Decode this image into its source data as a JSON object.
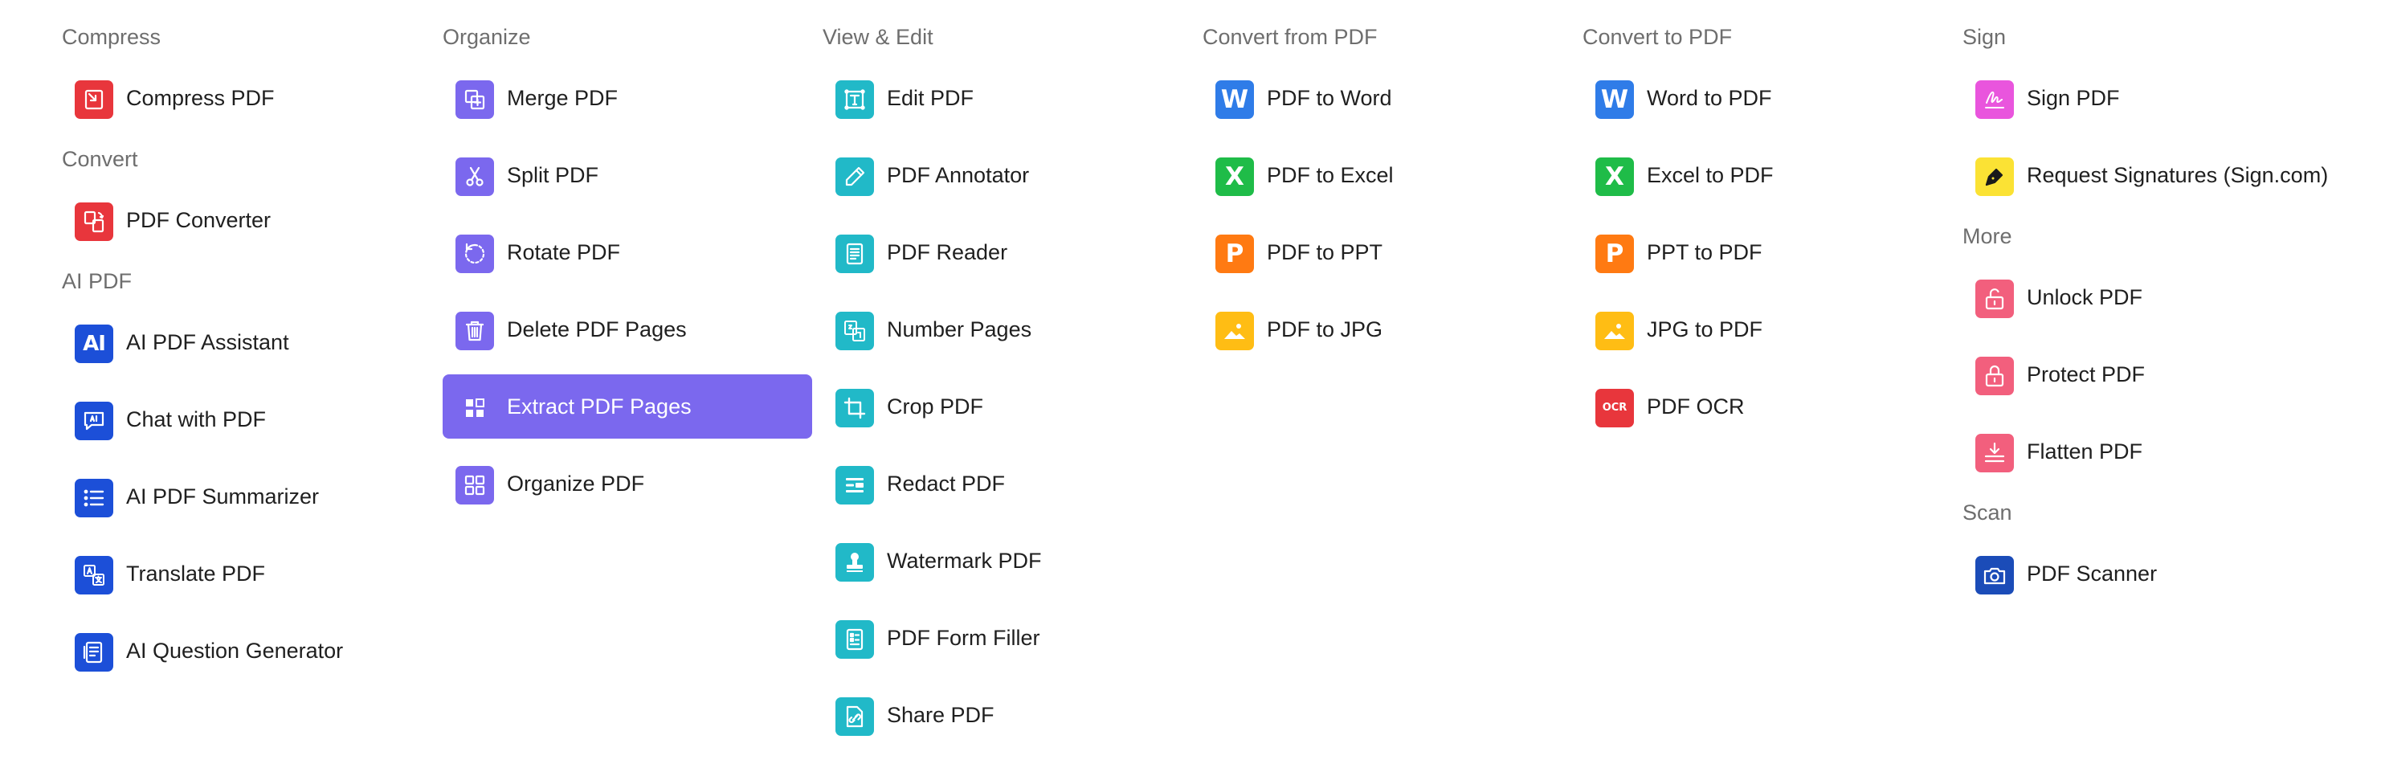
{
  "colors": {
    "red": "#e8363c",
    "purple": "#7b68ee",
    "teal": "#21b9c8",
    "blue": "#1c4fd8",
    "word_blue": "#2f7ce8",
    "excel_green": "#1fbc48",
    "ppt_orange": "#ff7a12",
    "jpg_yellow": "#ffbd14",
    "sign_magenta": "#e955dd",
    "sign_yellow": "#fbe234",
    "pink": "#f25f7d",
    "navy": "#1b4cb8",
    "active_bg": "#7b68ee"
  },
  "columns": [
    {
      "sections": [
        {
          "title": "Compress",
          "items": [
            {
              "label": "Compress PDF",
              "icon": "compress-icon"
            }
          ]
        },
        {
          "title": "Convert",
          "items": [
            {
              "label": "PDF Converter",
              "icon": "converter-icon"
            }
          ]
        },
        {
          "title": "AI PDF",
          "items": [
            {
              "label": "AI PDF Assistant",
              "icon": "ai-icon"
            },
            {
              "label": "Chat with PDF",
              "icon": "chat-icon"
            },
            {
              "label": "AI PDF Summarizer",
              "icon": "list-icon"
            },
            {
              "label": "Translate PDF",
              "icon": "translate-icon"
            },
            {
              "label": "AI Question Generator",
              "icon": "question-icon"
            }
          ]
        }
      ]
    },
    {
      "sections": [
        {
          "title": "Organize",
          "items": [
            {
              "label": "Merge PDF",
              "icon": "merge-icon"
            },
            {
              "label": "Split PDF",
              "icon": "scissors-icon"
            },
            {
              "label": "Rotate PDF",
              "icon": "rotate-icon"
            },
            {
              "label": "Delete PDF Pages",
              "icon": "trash-icon"
            },
            {
              "label": "Extract PDF Pages",
              "icon": "extract-icon",
              "active": true
            },
            {
              "label": "Organize PDF",
              "icon": "grid-icon"
            }
          ]
        }
      ]
    },
    {
      "sections": [
        {
          "title": "View & Edit",
          "items": [
            {
              "label": "Edit PDF",
              "icon": "text-edit-icon"
            },
            {
              "label": "PDF Annotator",
              "icon": "pencil-icon"
            },
            {
              "label": "PDF Reader",
              "icon": "document-icon"
            },
            {
              "label": "Number Pages",
              "icon": "number-pages-icon"
            },
            {
              "label": "Crop PDF",
              "icon": "crop-icon"
            },
            {
              "label": "Redact PDF",
              "icon": "redact-icon"
            },
            {
              "label": "Watermark PDF",
              "icon": "stamp-icon"
            },
            {
              "label": "PDF Form Filler",
              "icon": "form-icon"
            },
            {
              "label": "Share PDF",
              "icon": "share-icon"
            }
          ]
        }
      ]
    },
    {
      "sections": [
        {
          "title": "Convert from PDF",
          "items": [
            {
              "label": "PDF to Word",
              "icon": "word-icon"
            },
            {
              "label": "PDF to Excel",
              "icon": "excel-icon"
            },
            {
              "label": "PDF to PPT",
              "icon": "ppt-icon"
            },
            {
              "label": "PDF to JPG",
              "icon": "image-icon"
            }
          ]
        }
      ]
    },
    {
      "sections": [
        {
          "title": "Convert to PDF",
          "items": [
            {
              "label": "Word to PDF",
              "icon": "word-icon"
            },
            {
              "label": "Excel to PDF",
              "icon": "excel-icon"
            },
            {
              "label": "PPT to PDF",
              "icon": "ppt-icon"
            },
            {
              "label": "JPG to PDF",
              "icon": "image-icon"
            },
            {
              "label": "PDF OCR",
              "icon": "ocr-icon"
            }
          ]
        }
      ]
    },
    {
      "sections": [
        {
          "title": "Sign",
          "items": [
            {
              "label": "Sign PDF",
              "icon": "signature-icon"
            },
            {
              "label": "Request Signatures (Sign.com)",
              "icon": "pen-nib-icon"
            }
          ]
        },
        {
          "title": "More",
          "items": [
            {
              "label": "Unlock PDF",
              "icon": "unlock-icon"
            },
            {
              "label": "Protect PDF",
              "icon": "lock-icon"
            },
            {
              "label": "Flatten PDF",
              "icon": "flatten-icon"
            }
          ]
        },
        {
          "title": "Scan",
          "items": [
            {
              "label": "PDF Scanner",
              "icon": "camera-icon"
            }
          ]
        }
      ]
    }
  ],
  "icon_text": {
    "ai": "AI",
    "word": "W",
    "excel": "X",
    "ppt": "P",
    "ocr": "OCR"
  }
}
